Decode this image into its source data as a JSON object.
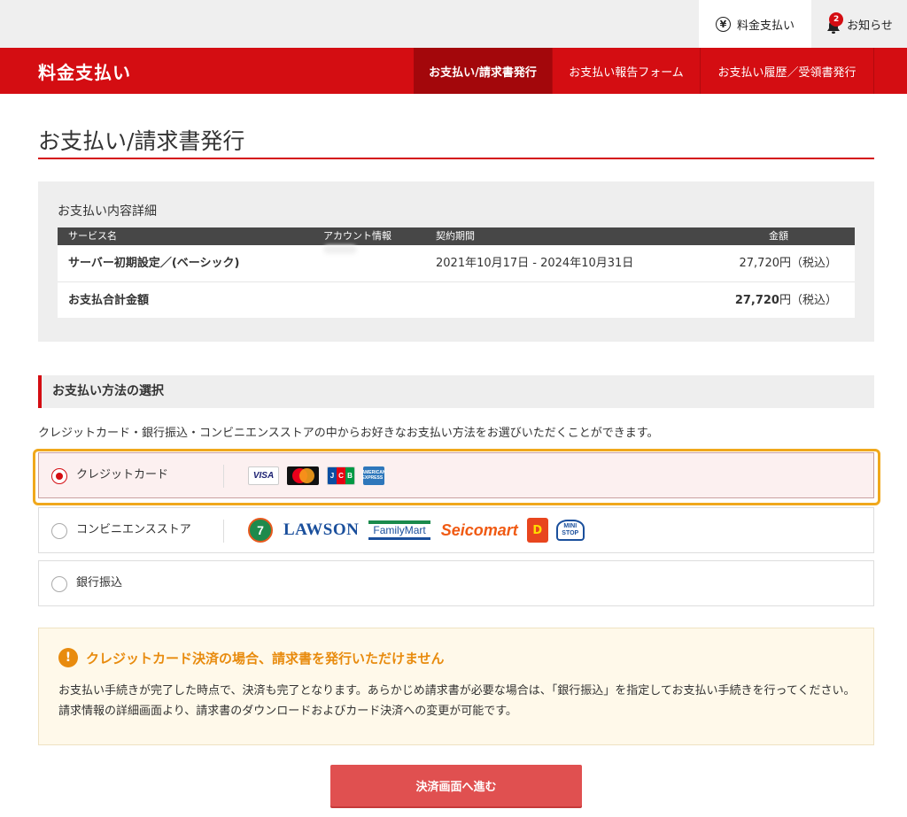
{
  "utility": {
    "payment_label": "料金支払い",
    "notify_label": "お知らせ",
    "notify_count": "2"
  },
  "header": {
    "brand": "料金支払い",
    "tabs": [
      {
        "label": "お支払い/請求書発行"
      },
      {
        "label": "お支払い報告フォーム"
      },
      {
        "label": "お支払い履歴／受領書発行"
      }
    ]
  },
  "page": {
    "title": "お支払い/請求書発行"
  },
  "details": {
    "heading": "お支払い内容詳細",
    "columns": [
      "サービス名",
      "アカウント情報",
      "契約期間",
      "金額"
    ],
    "row": {
      "service": "サーバー初期設定／(ベーシック)",
      "period": "2021年10月17日 - 2024年10月31日",
      "amount": "27,720円（税込）"
    },
    "total": {
      "label": "お支払合計金額",
      "amount": "27,720",
      "suffix": "円（税込）"
    }
  },
  "method": {
    "heading": "お支払い方法の選択",
    "description": "クレジットカード・銀行振込・コンビニエンスストアの中からお好きなお支払い方法をお選びいただくことができます。",
    "options": [
      {
        "label": "クレジットカード",
        "selected": true
      },
      {
        "label": "コンビニエンスストア",
        "selected": false
      },
      {
        "label": "銀行振込",
        "selected": false
      }
    ],
    "card_logos": {
      "visa": "VISA",
      "jcb": [
        "J",
        "C",
        "B"
      ],
      "amex": "AMERICAN EXPRESS"
    },
    "store_logos": {
      "seven": "7",
      "lawson": "LAWSON",
      "familymart": "FamilyMart",
      "seicomart": "Seicomart",
      "daily": "D",
      "ministop": "MINI STOP"
    }
  },
  "notice": {
    "title": "クレジットカード決済の場合、請求書を発行いただけません",
    "body": "お支払い手続きが完了した時点で、決済も完了となります。あらかじめ請求書が必要な場合は、「銀行振込」を指定してお支払い手続きを行ってください。請求情報の詳細画面より、請求書のダウンロードおよびカード決済への変更が可能です。"
  },
  "actions": {
    "proceed_label": "決済画面へ進む"
  },
  "colors": {
    "brand_red": "#d40d12",
    "warning_orange": "#e88b0e",
    "button_red": "#e05050"
  }
}
